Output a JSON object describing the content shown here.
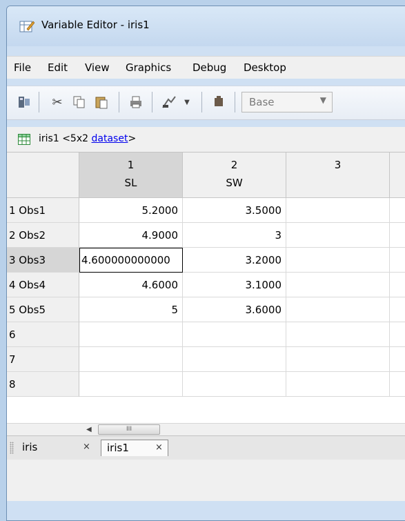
{
  "window": {
    "title": "Variable Editor - iris1"
  },
  "menu": [
    "File",
    "Edit",
    "View",
    "Graphics",
    "Debug",
    "Desktop"
  ],
  "toolbar": {
    "icons": [
      "import-data-icon",
      "cut-icon",
      "copy-icon",
      "paste-icon",
      "print-icon",
      "plot-icon",
      "dropdown-arrow-icon",
      "stack-icon"
    ],
    "workspace_select": "Base"
  },
  "info": {
    "name": "iris1",
    "size": "<5x2",
    "class_link": "dataset",
    "suffix": ">"
  },
  "grid": {
    "columns": [
      {
        "num": "1",
        "name": "SL"
      },
      {
        "num": "2",
        "name": "SW"
      },
      {
        "num": "3",
        "name": ""
      }
    ],
    "rows": [
      {
        "label": "1 Obs1",
        "values": [
          "5.2000",
          "3.5000",
          ""
        ]
      },
      {
        "label": "2 Obs2",
        "values": [
          "4.9000",
          "3",
          ""
        ]
      },
      {
        "label": "3 Obs3",
        "values": [
          "4.600000000000",
          "3.2000",
          ""
        ]
      },
      {
        "label": "4 Obs4",
        "values": [
          "4.6000",
          "3.1000",
          ""
        ]
      },
      {
        "label": "5 Obs5",
        "values": [
          "5",
          "3.6000",
          ""
        ]
      },
      {
        "label": "6",
        "values": [
          "",
          "",
          ""
        ]
      },
      {
        "label": "7",
        "values": [
          "",
          "",
          ""
        ]
      },
      {
        "label": "8",
        "values": [
          "",
          "",
          ""
        ]
      }
    ]
  },
  "scroll": {
    "thumb_glyph": "III"
  },
  "tabs": [
    {
      "label": "iris",
      "close": "×"
    },
    {
      "label": "iris1",
      "close": "×"
    }
  ],
  "colors": {
    "titlebar": "#c4d8ef",
    "selection": "#d6d6d6",
    "link": "#0000ee"
  }
}
